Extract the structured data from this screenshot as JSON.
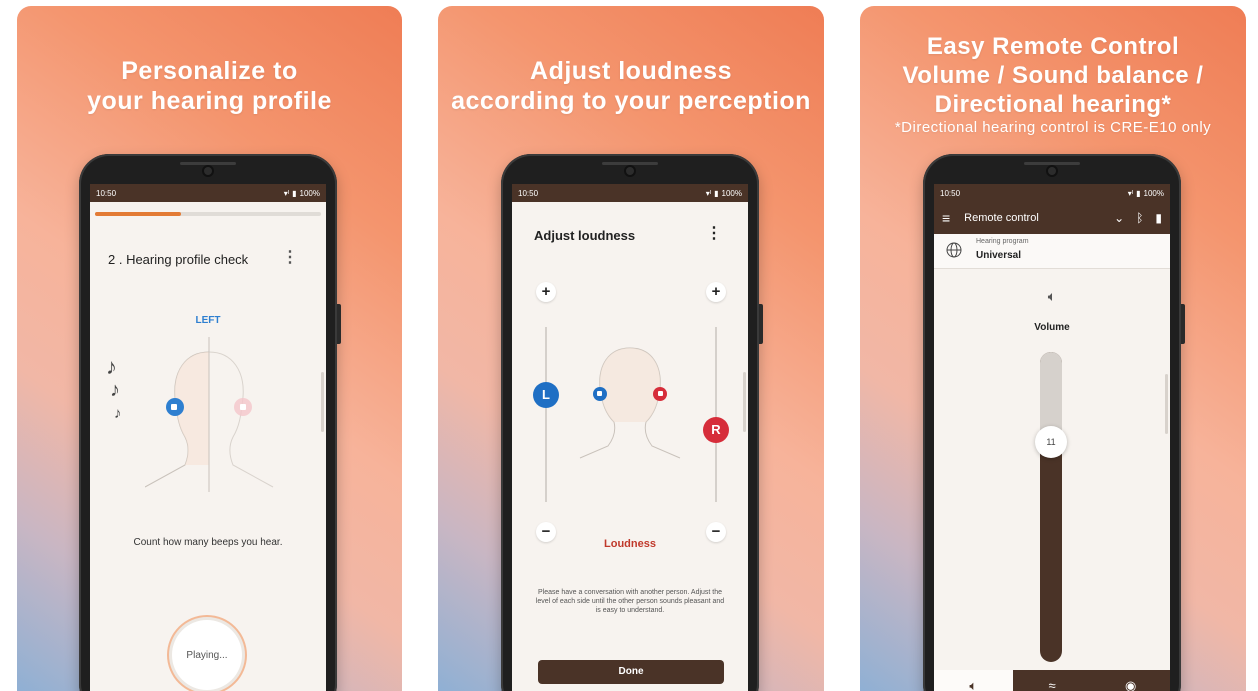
{
  "cards": [
    {
      "headline_lines": [
        "Personalize to",
        "your hearing profile"
      ],
      "status": {
        "time": "10:50",
        "battery": "100%"
      },
      "screen": {
        "title": "2 . Hearing profile check",
        "ear_label": "LEFT",
        "instruction": "Count how many beeps you hear.",
        "playing_label": "Playing...",
        "progress": 0.38
      }
    },
    {
      "headline_lines": [
        "Adjust loudness",
        "according to your perception"
      ],
      "status": {
        "time": "10:50",
        "battery": "100%"
      },
      "screen": {
        "title": "Adjust loudness",
        "plus": "+",
        "minus": "−",
        "left_knob": "L",
        "right_knob": "R",
        "loudness_label": "Loudness",
        "hint": "Please have a conversation with another person. Adjust the level of each side until the other person sounds pleasant and is easy to understand.",
        "done_label": "Done"
      }
    },
    {
      "headline_lines": [
        "Easy Remote Control",
        "Volume / Sound balance /",
        "Directional hearing*"
      ],
      "footnote": "*Directional hearing control is CRE-E10 only",
      "status": {
        "time": "10:50",
        "battery": "100%"
      },
      "screen": {
        "appbar_title": "Remote control",
        "hearing_program_label": "Hearing program",
        "hearing_program_value": "Universal",
        "volume_label": "Volume",
        "volume_value": "11"
      }
    }
  ],
  "colors": {
    "brown": "#4a3327",
    "orange": "#e37b35",
    "blue_knob": "#1f6fc4",
    "red_knob": "#d62d3a"
  },
  "icons": [
    "menu-icon",
    "chevron-down-icon",
    "bluetooth-icon",
    "battery-icon",
    "speaker-icon",
    "globe-icon",
    "sound-balance-icon",
    "directional-icon",
    "kebab-menu-icon",
    "music-notes-icon"
  ]
}
